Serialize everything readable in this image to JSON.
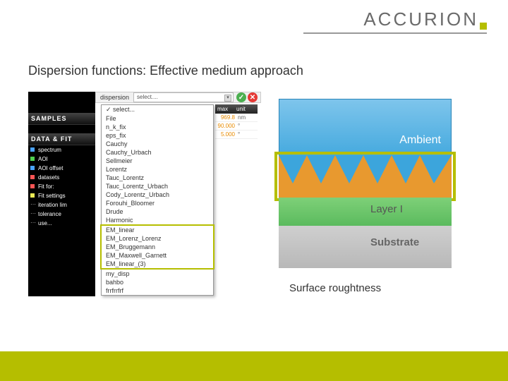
{
  "logo": {
    "text": "ACCURION"
  },
  "title": "Dispersion functions: Effective medium approach",
  "caption": "Surface roughtness",
  "dispersion_label": "dispersion",
  "select_placeholder": "select....",
  "sidebar": {
    "samples_header": "SAMPLES",
    "datafit_header": "DATA & FIT",
    "items": [
      {
        "label": "spectrum"
      },
      {
        "label": "AOI"
      },
      {
        "label": "AOI offset"
      },
      {
        "label": "datasets"
      },
      {
        "label": "Fit for:"
      },
      {
        "label": "Fit settings"
      },
      {
        "label": "iteration lim"
      },
      {
        "label": "tolerance"
      },
      {
        "label": "use..."
      }
    ]
  },
  "dropdown": {
    "items": [
      "select...",
      "File",
      "n_k_fix",
      "eps_fix",
      "Cauchy",
      "Cauchy_Urbach",
      "Sellmeier",
      "Lorentz",
      "Tauc_Lorentz",
      "Tauc_Lorentz_Urbach",
      "Cody_Lorentz_Urbach",
      "Forouhi_Bloomer",
      "Drude",
      "Harmonic"
    ],
    "em_items": [
      "EM_linear",
      "EM_Lorenz_Lorenz",
      "EM_Bruggemann",
      "EM_Maxwell_Garnett",
      "EM_linear_(3)"
    ],
    "tail_items": [
      "my_disp",
      "bahbo",
      "frrfrrfrf"
    ]
  },
  "right_cols": {
    "h1": "max",
    "h2": "unit",
    "rows": [
      {
        "val": "969.8",
        "unit": "nm"
      },
      {
        "val": "90.000",
        "unit": "°"
      },
      {
        "val": "5.000",
        "unit": "°"
      }
    ]
  },
  "layers": {
    "ambient": "Ambient",
    "layer1": "Layer I",
    "substrate": "Substrate"
  }
}
